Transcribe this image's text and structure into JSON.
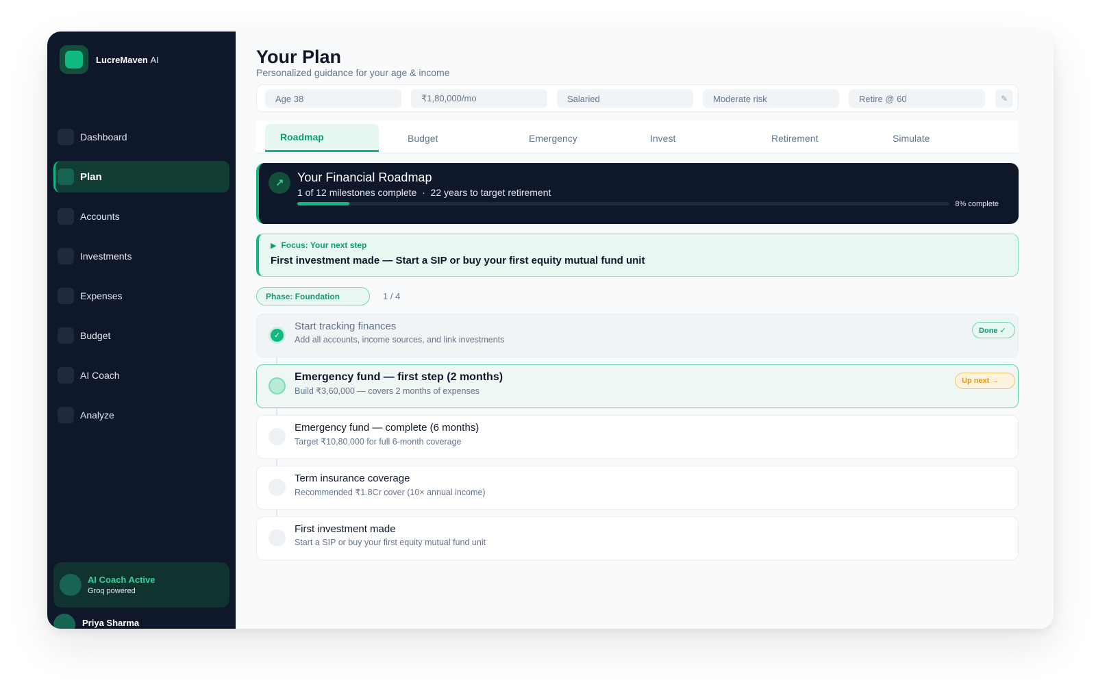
{
  "brand": {
    "name_bold": "LucreMaven",
    "name_thin": "AI"
  },
  "nav": [
    {
      "id": "dashboard",
      "label": "Dashboard",
      "active": false
    },
    {
      "id": "plan",
      "label": "Plan",
      "active": true
    },
    {
      "id": "accounts",
      "label": "Accounts",
      "active": false
    },
    {
      "id": "investments",
      "label": "Investments",
      "active": false
    },
    {
      "id": "expenses",
      "label": "Expenses",
      "active": false
    },
    {
      "id": "budget",
      "label": "Budget",
      "active": false
    },
    {
      "id": "ai-coach",
      "label": "AI Coach",
      "active": false
    },
    {
      "id": "analyze",
      "label": "Analyze",
      "active": false
    }
  ],
  "coach": {
    "title": "AI Coach Active",
    "subtitle": "Groq powered"
  },
  "user": {
    "name": "Priya Sharma"
  },
  "page": {
    "title": "Your Plan",
    "subtitle": "Personalized guidance for your age & income"
  },
  "profile": {
    "chips": [
      "Age 38",
      "₹1,80,000/mo",
      "Salaried",
      "Moderate risk",
      "Retire @ 60"
    ],
    "edit_icon": "pencil-icon"
  },
  "tabs": [
    {
      "id": "roadmap",
      "label": "Roadmap",
      "active": true
    },
    {
      "id": "budget",
      "label": "Budget",
      "active": false
    },
    {
      "id": "emergency",
      "label": "Emergency",
      "active": false
    },
    {
      "id": "invest",
      "label": "Invest",
      "active": false
    },
    {
      "id": "retirement",
      "label": "Retirement",
      "active": false
    },
    {
      "id": "simulate",
      "label": "Simulate",
      "active": false
    }
  ],
  "roadmap": {
    "title": "Your Financial Roadmap",
    "subtitle": "1 of 12 milestones complete  ·  22 years to target retirement",
    "progress": 0.08,
    "progress_label": "8% complete",
    "icon": "trend-up-arrow-icon"
  },
  "focus": {
    "label": "Focus: Your next step",
    "text": "First investment made — Start a SIP or buy your first equity mutual fund unit"
  },
  "phase": {
    "label": "Phase: Foundation",
    "count": "1 / 4"
  },
  "milestones": [
    {
      "title": "Start tracking finances",
      "desc": "Add all accounts, income sources, and link investments",
      "status": "done",
      "badge": "Done ✓"
    },
    {
      "title": "Emergency fund — first step (2 months)",
      "desc": "Build ₹3,60,000 — covers 2 months of expenses",
      "status": "next",
      "badge": "Up next →"
    },
    {
      "title": "Emergency fund — complete (6 months)",
      "desc": "Target ₹10,80,000 for full 6-month coverage",
      "status": "todo",
      "badge": ""
    },
    {
      "title": "Term insurance coverage",
      "desc": "Recommended ₹1.8Cr cover (10× annual income)",
      "status": "todo",
      "badge": ""
    },
    {
      "title": "First investment made",
      "desc": "Start a SIP or buy your first equity mutual fund unit",
      "status": "todo",
      "badge": ""
    }
  ],
  "colors": {
    "accent": "#10b981",
    "sidebar": "#0f172a",
    "warning": "#e59b0c"
  }
}
